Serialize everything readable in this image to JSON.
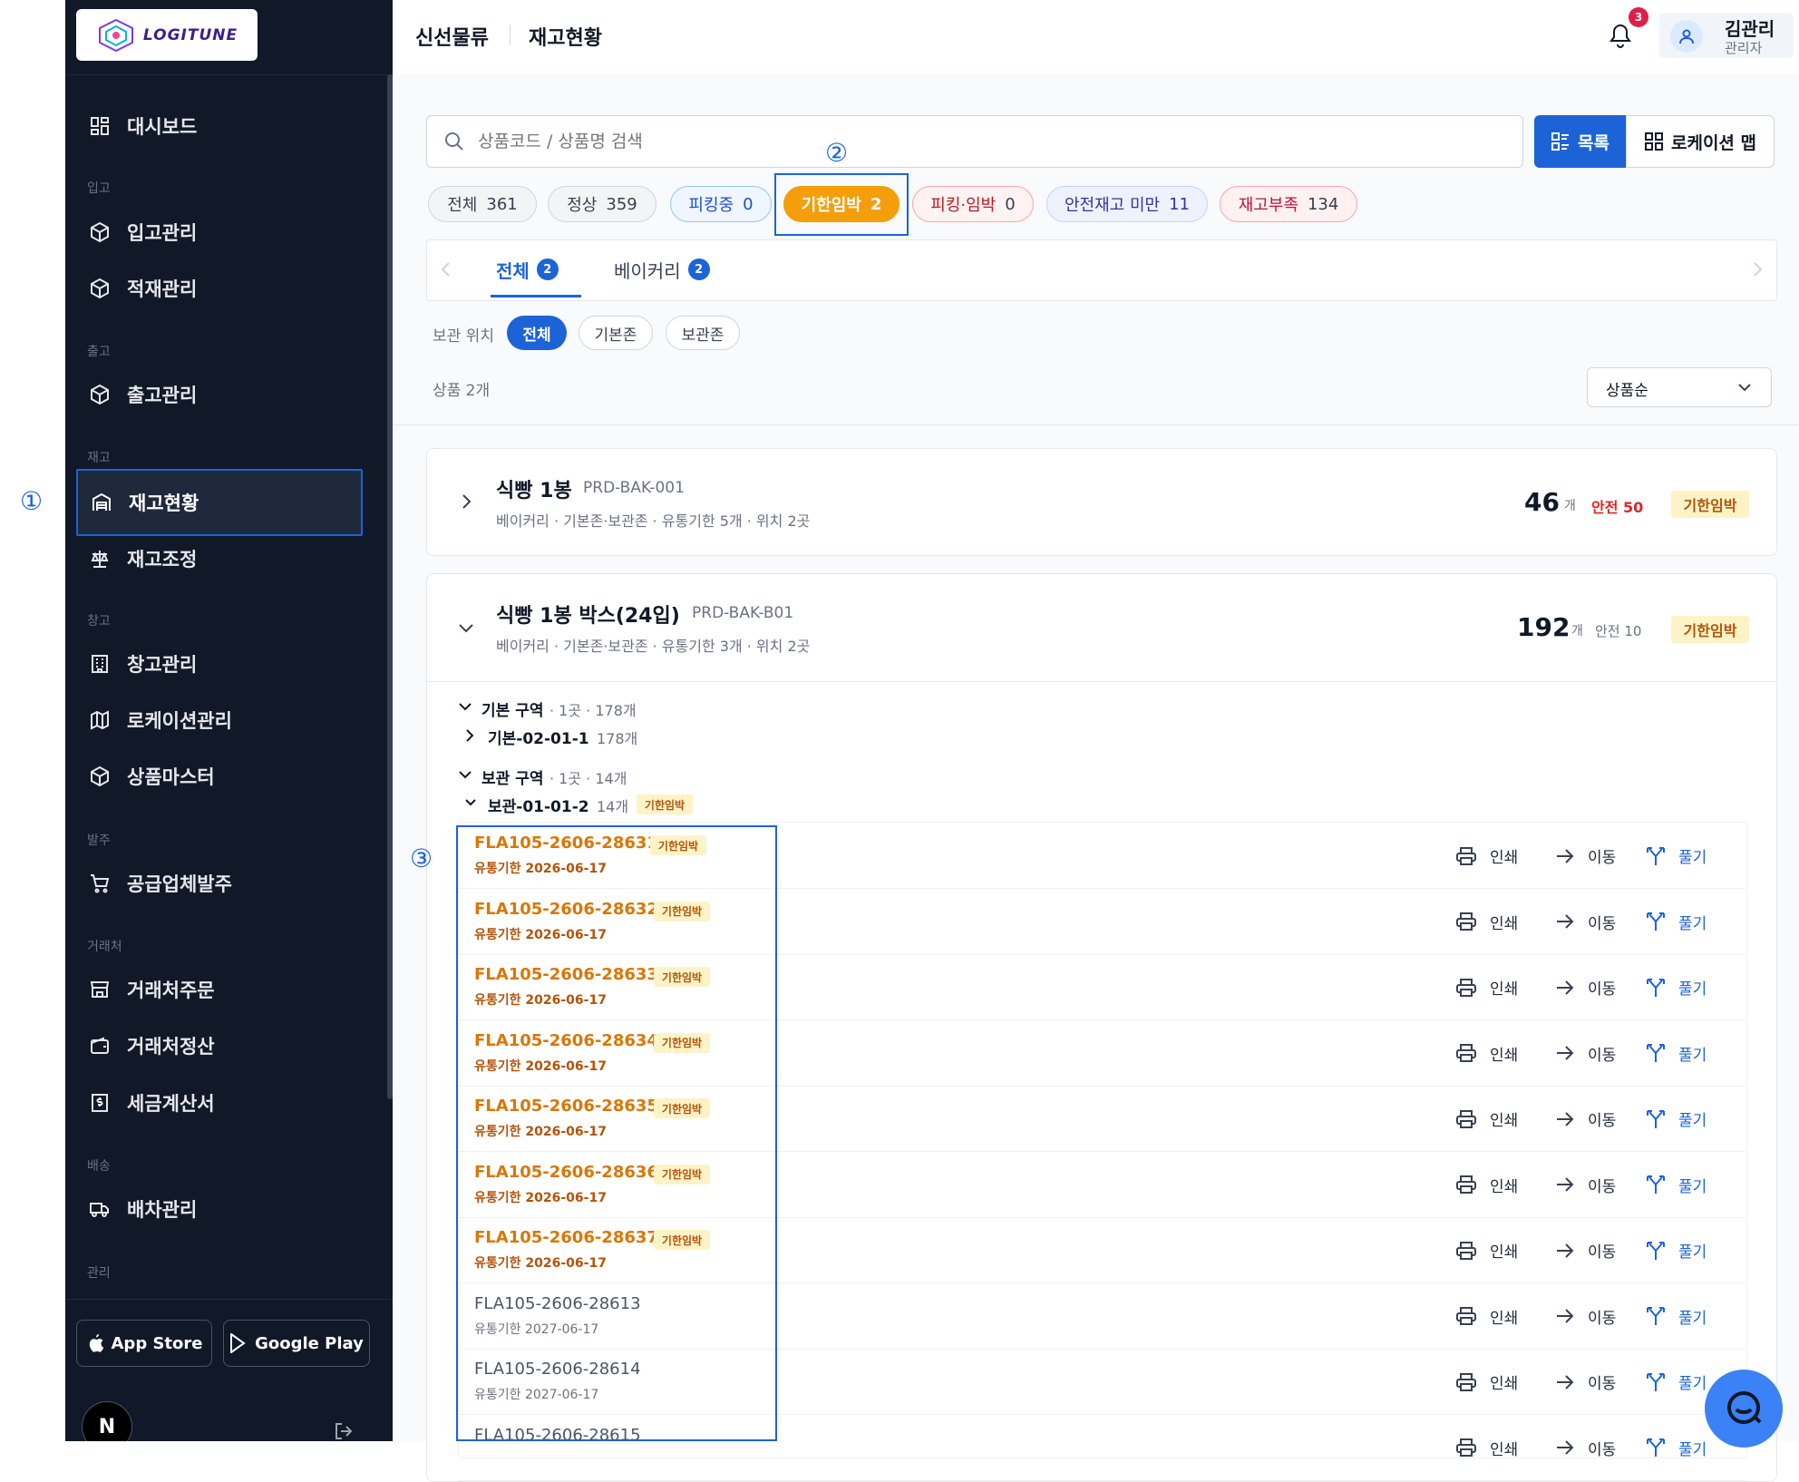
{
  "sidebar": {
    "logo": "LOGITUNE",
    "sections": {
      "inbound": "입고",
      "outbound": "출고",
      "inventory": "재고",
      "warehouse": "창고",
      "order": "발주",
      "partner": "거래처",
      "delivery": "배송",
      "admin": "관리"
    },
    "items": {
      "dashboard": "대시보드",
      "inbound_mgmt": "입고관리",
      "stacking": "적재관리",
      "outbound_mgmt": "출고관리",
      "stock_status": "재고현황",
      "stock_adjust": "재고조정",
      "warehouse_mgmt": "창고관리",
      "location_mgmt": "로케이션관리",
      "product_master": "상품마스터",
      "supplier_order": "공급업체발주",
      "partner_order": "거래처주문",
      "partner_settle": "거래처정산",
      "tax_invoice": "세금계산서",
      "dispatch": "배차관리"
    },
    "app_store": "App Store",
    "google_play": "Google Play",
    "avatar_letter": "N"
  },
  "markers": {
    "m1": "①",
    "m2": "②",
    "m3": "③"
  },
  "header": {
    "crumb1": "신선물류",
    "crumb2": "재고현황",
    "notif_count": "3",
    "user_name": "김관리",
    "user_role": "관리자"
  },
  "search": {
    "placeholder": "상품코드 / 상품명 검색"
  },
  "view": {
    "list": "목록",
    "map": "로케이션 맵"
  },
  "status_chips": [
    {
      "label": "전체",
      "count": "361"
    },
    {
      "label": "정상",
      "count": "359"
    },
    {
      "label": "피킹중",
      "count": "0"
    },
    {
      "label": "기한임박",
      "count": "2"
    },
    {
      "label": "피킹·임박",
      "count": "0"
    },
    {
      "label": "안전재고 미만",
      "count": "11"
    },
    {
      "label": "재고부족",
      "count": "134"
    }
  ],
  "tabs": [
    {
      "label": "전체",
      "count": "2"
    },
    {
      "label": "베이커리",
      "count": "2"
    }
  ],
  "storage": {
    "label": "보관 위치",
    "options": [
      "전체",
      "기본존",
      "보관존"
    ]
  },
  "product_count": "상품 2개",
  "sort": "상품순",
  "products": [
    {
      "name": "식빵 1봉",
      "code": "PRD-BAK-001",
      "meta": "베이커리 · 기본존·보관존 · 유통기한 5개 · 위치 2곳",
      "qty": "46",
      "unit": "개",
      "safety": "안전 50",
      "tag": "기한임박"
    },
    {
      "name": "식빵 1봉 박스(24입)",
      "code": "PRD-BAK-B01",
      "meta": "베이커리 · 기본존·보관존 · 유통기한 3개 · 위치 2곳",
      "qty": "192",
      "unit": "개",
      "safety": "안전 10",
      "tag": "기한임박"
    }
  ],
  "zones": {
    "basic": {
      "name": "기본 구역",
      "meta": "· 1곳 · 178개",
      "loc": "기본-02-01-1",
      "loc_qty": "178개"
    },
    "storage": {
      "name": "보관 구역",
      "meta": "· 1곳 · 14개",
      "loc": "보관-01-01-2",
      "loc_qty": "14개",
      "tag": "기한임박"
    }
  },
  "lot_actions": {
    "print": "인쇄",
    "move": "이동",
    "split": "풀기"
  },
  "lots": [
    {
      "code": "FLA105-2606-28631",
      "date": "유통기한 2026-06-17",
      "tag": "기한임박"
    },
    {
      "code": "FLA105-2606-28632",
      "date": "유통기한 2026-06-17",
      "tag": "기한임박"
    },
    {
      "code": "FLA105-2606-28633",
      "date": "유통기한 2026-06-17",
      "tag": "기한임박"
    },
    {
      "code": "FLA105-2606-28634",
      "date": "유통기한 2026-06-17",
      "tag": "기한임박"
    },
    {
      "code": "FLA105-2606-28635",
      "date": "유통기한 2026-06-17",
      "tag": "기한임박"
    },
    {
      "code": "FLA105-2606-28636",
      "date": "유통기한 2026-06-17",
      "tag": "기한임박"
    },
    {
      "code": "FLA105-2606-28637",
      "date": "유통기한 2026-06-17",
      "tag": "기한임박"
    },
    {
      "code": "FLA105-2606-28613",
      "date": "유통기한 2027-06-17",
      "tag": ""
    },
    {
      "code": "FLA105-2606-28614",
      "date": "유통기한 2027-06-17",
      "tag": ""
    },
    {
      "code": "FLA105-2606-28615",
      "date": "",
      "tag": ""
    }
  ]
}
